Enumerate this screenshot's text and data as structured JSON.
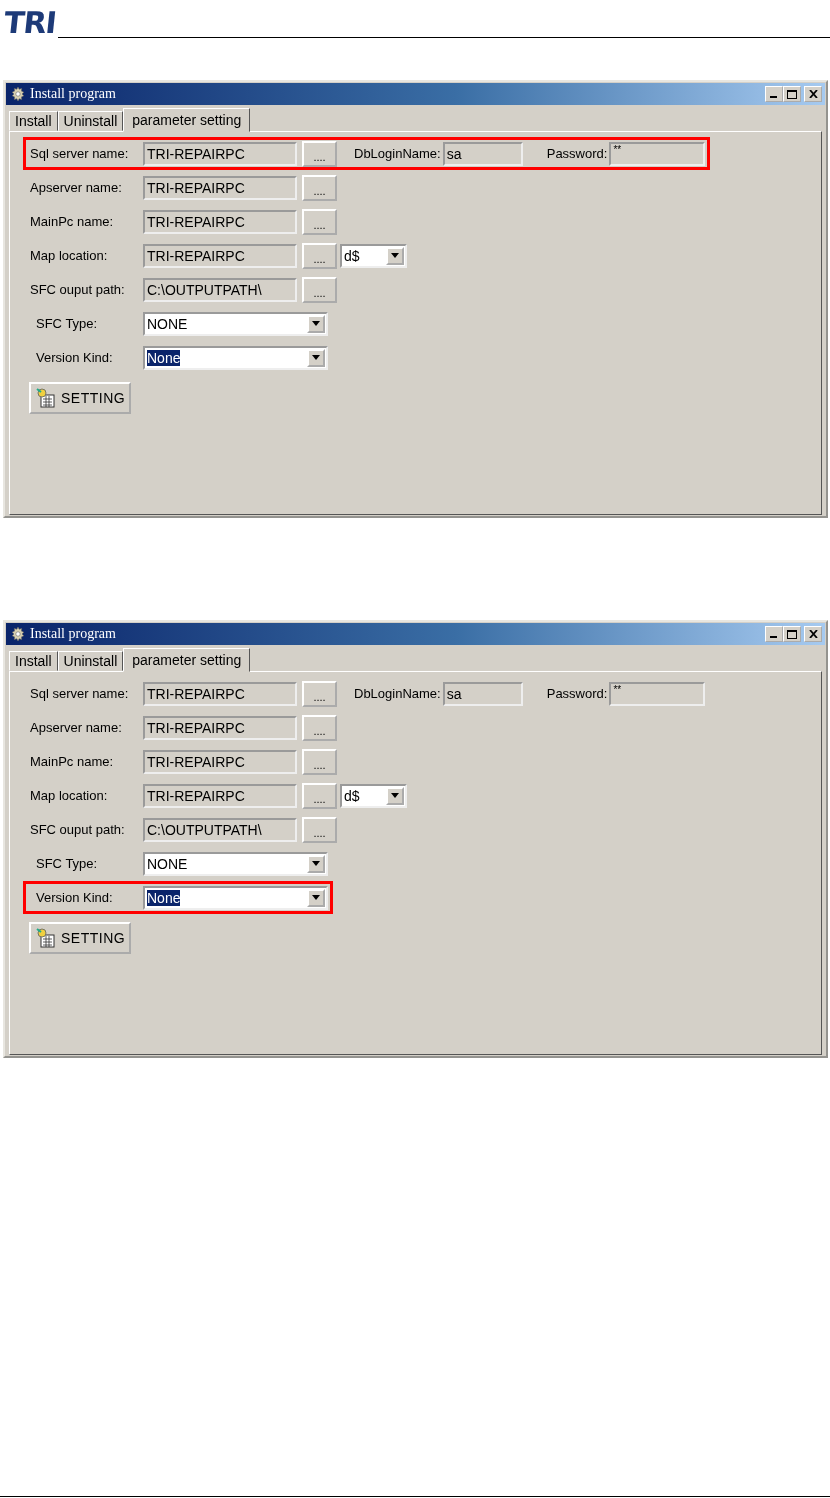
{
  "header": {
    "logo": "TRI"
  },
  "windows": [
    {
      "title": "Install program",
      "tabs": [
        {
          "label": "Install",
          "selected": false
        },
        {
          "label": "Uninstall",
          "selected": false
        },
        {
          "label": "parameter setting",
          "selected": true
        }
      ],
      "rows": [
        {
          "kind": "path",
          "label": "Sql server name:",
          "value": "TRI-REPAIRPC",
          "browse": "....",
          "highlighted": true,
          "extras": [
            {
              "label": "DbLoginName:",
              "value": "sa"
            },
            {
              "label": "Password:",
              "value": "**"
            }
          ]
        },
        {
          "kind": "path",
          "label": "Apserver name:",
          "value": "TRI-REPAIRPC",
          "browse": "....",
          "highlighted": false
        },
        {
          "kind": "path",
          "label": "MainPc name:",
          "value": "TRI-REPAIRPC",
          "browse": "....",
          "highlighted": false
        },
        {
          "kind": "path",
          "label": "Map location:",
          "value": "TRI-REPAIRPC",
          "browse": "....",
          "drive": "d$",
          "highlighted": false
        },
        {
          "kind": "path",
          "label": "SFC ouput path:",
          "value": "C:\\OUTPUTPATH\\",
          "browse": "....",
          "highlighted": false
        },
        {
          "kind": "combo",
          "label": "SFC Type:",
          "value": "NONE",
          "value_selected": false,
          "highlighted": false
        },
        {
          "kind": "combo",
          "label": "Version Kind:",
          "value": "None",
          "value_selected": true,
          "highlighted": false
        }
      ],
      "button": "SETTING"
    },
    {
      "title": "Install program",
      "tabs": [
        {
          "label": "Install",
          "selected": false
        },
        {
          "label": "Uninstall",
          "selected": false
        },
        {
          "label": "parameter setting",
          "selected": true
        }
      ],
      "rows": [
        {
          "kind": "path",
          "label": "Sql server name:",
          "value": "TRI-REPAIRPC",
          "browse": "....",
          "highlighted": false,
          "extras": [
            {
              "label": "DbLoginName:",
              "value": "sa"
            },
            {
              "label": "Password:",
              "value": "**"
            }
          ]
        },
        {
          "kind": "path",
          "label": "Apserver name:",
          "value": "TRI-REPAIRPC",
          "browse": "....",
          "highlighted": false
        },
        {
          "kind": "path",
          "label": "MainPc name:",
          "value": "TRI-REPAIRPC",
          "browse": "....",
          "highlighted": false
        },
        {
          "kind": "path",
          "label": "Map location:",
          "value": "TRI-REPAIRPC",
          "browse": "....",
          "drive": "d$",
          "highlighted": false
        },
        {
          "kind": "path",
          "label": "SFC ouput path:",
          "value": "C:\\OUTPUTPATH\\",
          "browse": "....",
          "highlighted": false
        },
        {
          "kind": "combo",
          "label": "SFC Type:",
          "value": "NONE",
          "value_selected": false,
          "highlighted": false
        },
        {
          "kind": "combo",
          "label": "Version Kind:",
          "value": "None",
          "value_selected": true,
          "highlighted": true
        }
      ],
      "button": "SETTING"
    }
  ]
}
